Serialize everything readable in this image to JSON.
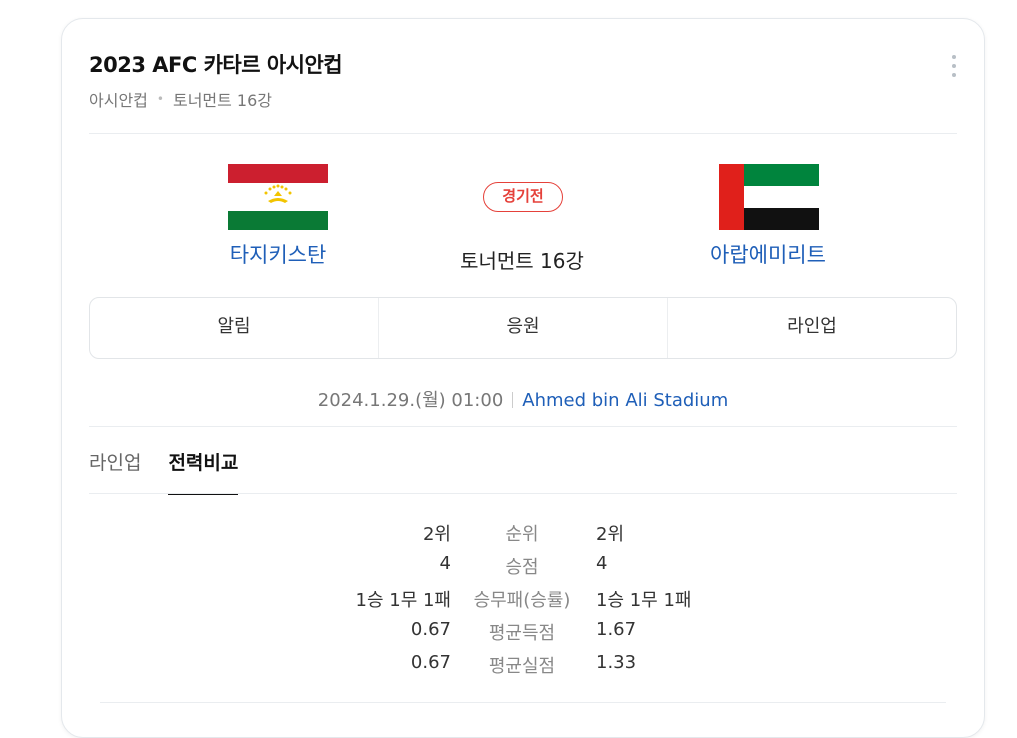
{
  "header": {
    "title": "2023 AFC 카타르 아시안컵",
    "league": "아시안컵",
    "stage": "토너먼트 16강"
  },
  "match": {
    "home_team": "타지키스탄",
    "away_team": "아랍에미리트",
    "status_badge": "경기전",
    "round": "토너먼트 16강",
    "datetime": "2024.1.29.(월) 01:00",
    "stadium": "Ahmed bin Ali Stadium"
  },
  "actions": [
    "알림",
    "응원",
    "라인업"
  ],
  "sub_tabs": [
    {
      "label": "라인업",
      "active": false
    },
    {
      "label": "전력비교",
      "active": true
    }
  ],
  "stats": [
    {
      "home": "2위",
      "label": "순위",
      "away": "2위"
    },
    {
      "home": "4",
      "label": "승점",
      "away": "4"
    },
    {
      "home": "1승 1무 1패",
      "label": "승무패(승률)",
      "away": "1승 1무 1패"
    },
    {
      "home": "0.67",
      "label": "평균득점",
      "away": "1.67"
    },
    {
      "home": "0.67",
      "label": "평균실점",
      "away": "1.33"
    }
  ],
  "icons": {
    "home_flag": "tajikistan-flag-icon",
    "away_flag": "uae-flag-icon",
    "more": "more-vertical-icon"
  },
  "colors": {
    "link": "#1f5fb8",
    "badge": "#e5413a"
  }
}
